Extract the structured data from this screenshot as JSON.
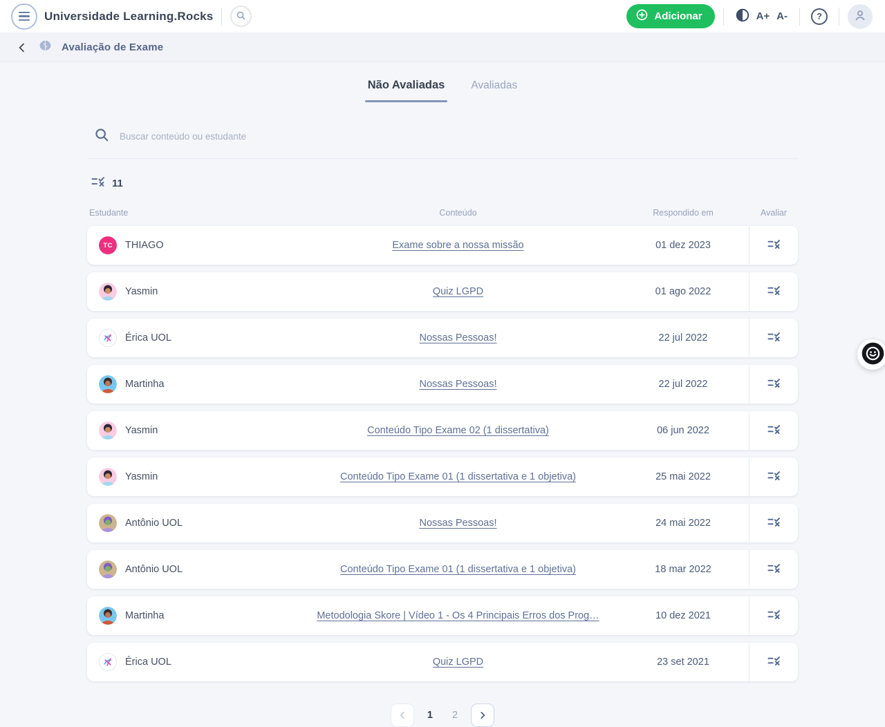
{
  "topbar": {
    "app_title": "Universidade Learning.Rocks",
    "add_button_label": "Adicionar",
    "add_button_color": "#1fbf5f",
    "font_increase_label": "A+",
    "font_decrease_label": "A-",
    "help_glyph": "?"
  },
  "breadcrumb": {
    "page_title": "Avaliação de Exame"
  },
  "tabs": {
    "active_label": "Não Avaliadas",
    "inactive_label": "Avaliadas"
  },
  "search": {
    "placeholder": "Buscar conteúdo ou estudante"
  },
  "list": {
    "count": "11",
    "columns": [
      "Estudante",
      "Conteúdo",
      "Respondido em",
      "Avaliar"
    ],
    "rows": [
      {
        "student": "THIAGO",
        "avatar": {
          "type": "initials",
          "bg": "#ed2f7e",
          "initials": "TC"
        },
        "content": "Exame sobre a nossa missão",
        "date": "01 dez 2023"
      },
      {
        "student": "Yasmin",
        "avatar": {
          "type": "person",
          "bg": "#f9cce2",
          "hair": "#2e2633",
          "skin": "#c98d66",
          "shirt": "#9fd7ef"
        },
        "content": "Quiz LGPD",
        "date": "01 ago 2022"
      },
      {
        "student": "Érica UOL",
        "avatar": {
          "type": "logo",
          "bg": "#ffffff"
        },
        "content": "Nossas Pessoas!",
        "date": "22 jul 2022"
      },
      {
        "student": "Martinha",
        "avatar": {
          "type": "person",
          "bg": "#79c7f0",
          "hair": "#3a2b28",
          "skin": "#b5765a",
          "shirt": "#cf5a38"
        },
        "content": "Nossas Pessoas!",
        "date": "22 jul 2022"
      },
      {
        "student": "Yasmin",
        "avatar": {
          "type": "person",
          "bg": "#f9cce2",
          "hair": "#2e2633",
          "skin": "#c98d66",
          "shirt": "#9fd7ef"
        },
        "content": "Conteúdo Tipo Exame 02 (1 dissertativa)",
        "date": "06 jun 2022"
      },
      {
        "student": "Yasmin",
        "avatar": {
          "type": "person",
          "bg": "#f9cce2",
          "hair": "#2e2633",
          "skin": "#c98d66",
          "shirt": "#9fd7ef"
        },
        "content": "Conteúdo Tipo Exame 01 (1 dissertativa e 1 objetiva)",
        "date": "25 mai 2022"
      },
      {
        "student": "Antônio UOL",
        "avatar": {
          "type": "person",
          "bg": "#cdb48e",
          "hair": "#7d5bc2",
          "skin": "#7fae6a",
          "shirt": "#a993dd"
        },
        "content": "Nossas Pessoas!",
        "date": "24 mai 2022"
      },
      {
        "student": "Antônio UOL",
        "avatar": {
          "type": "person",
          "bg": "#cdb48e",
          "hair": "#7d5bc2",
          "skin": "#7fae6a",
          "shirt": "#a993dd"
        },
        "content": "Conteúdo Tipo Exame 01 (1 dissertativa e 1 objetiva)",
        "date": "18 mar 2022"
      },
      {
        "student": "Martinha",
        "avatar": {
          "type": "person",
          "bg": "#79c7f0",
          "hair": "#3a2b28",
          "skin": "#b5765a",
          "shirt": "#cf5a38"
        },
        "content": "Metodologia Skore | Vídeo 1 - Os 4 Principais Erros dos Prog…",
        "date": "10 dez 2021"
      },
      {
        "student": "Érica UOL",
        "avatar": {
          "type": "logo",
          "bg": "#ffffff"
        },
        "content": "Quiz LGPD",
        "date": "23 set 2021"
      }
    ]
  },
  "pagination": {
    "pages": [
      "1",
      "2"
    ],
    "current": "1"
  }
}
